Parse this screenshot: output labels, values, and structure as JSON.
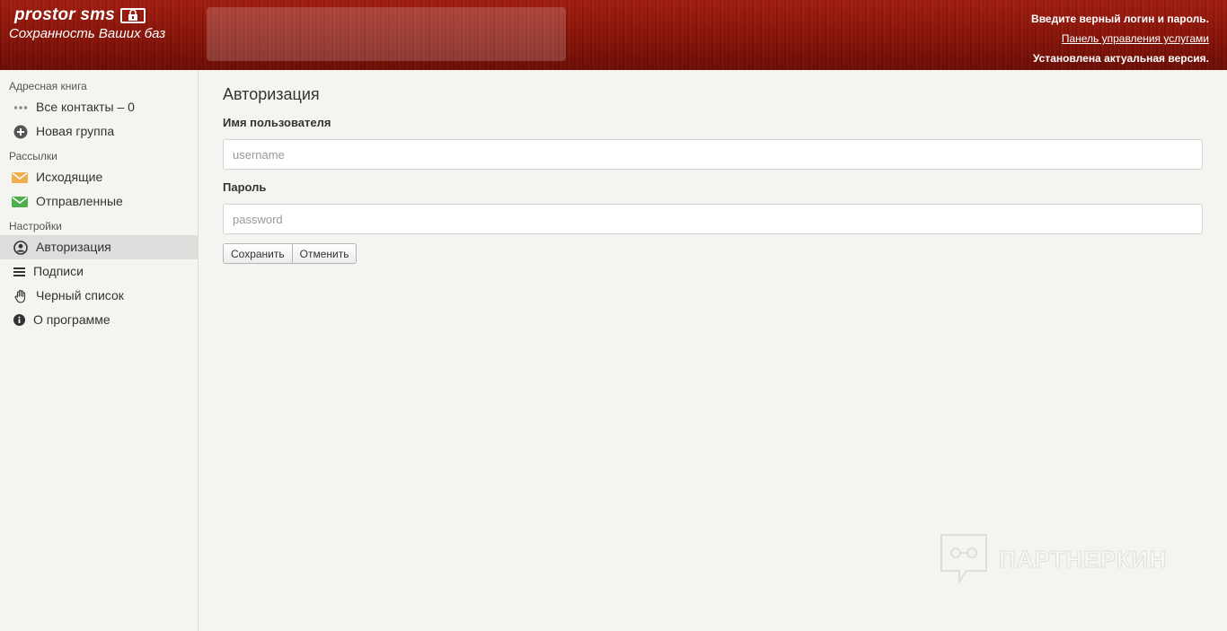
{
  "header": {
    "logo_title": "prostor sms",
    "logo_subtitle": "Сохранность Ваших баз",
    "message": "Введите верный логин и пароль.",
    "panel_link": "Панель управления услугами",
    "version": "Установлена актуальная версия."
  },
  "sidebar": {
    "sections": [
      {
        "title": "Адресная книга",
        "items": [
          {
            "label": "Все контакты – 0",
            "icon": "dots-icon"
          },
          {
            "label": "Новая группа",
            "icon": "plus-circle-icon"
          }
        ]
      },
      {
        "title": "Рассылки",
        "items": [
          {
            "label": "Исходящие",
            "icon": "envelope-icon",
            "color": "#f0ad4e"
          },
          {
            "label": "Отправленные",
            "icon": "envelope-icon",
            "color": "#4cae4c"
          }
        ]
      },
      {
        "title": "Настройки",
        "items": [
          {
            "label": "Авторизация",
            "icon": "user-circle-icon",
            "active": true
          },
          {
            "label": "Подписи",
            "icon": "list-icon"
          },
          {
            "label": "Черный список",
            "icon": "hand-icon"
          },
          {
            "label": "О программе",
            "icon": "info-icon"
          }
        ]
      }
    ]
  },
  "main": {
    "title": "Авторизация",
    "username_label": "Имя пользователя",
    "username_placeholder": "username",
    "password_label": "Пароль",
    "password_placeholder": "password",
    "save_label": "Сохранить",
    "cancel_label": "Отменить"
  },
  "watermark": {
    "text": "ПАРТНЕРКИН"
  }
}
